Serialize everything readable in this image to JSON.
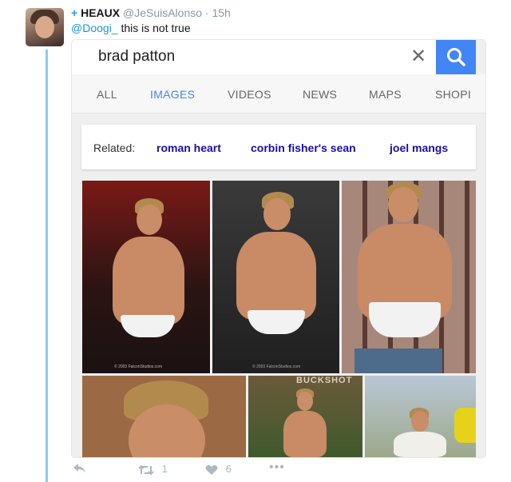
{
  "tweet": {
    "plus": "+",
    "author_name": "HEAUX",
    "handle": "@JeSuisAlonso",
    "separator": "·",
    "time": "15h",
    "mention": "@Doogi_",
    "text": " this is not true"
  },
  "search": {
    "query": "brad patton",
    "clear_icon": "close-icon",
    "search_icon": "search-icon",
    "accent": "#4285f4"
  },
  "tabs": [
    {
      "label": "ALL",
      "active": false
    },
    {
      "label": "IMAGES",
      "active": true
    },
    {
      "label": "VIDEOS",
      "active": false
    },
    {
      "label": "NEWS",
      "active": false
    },
    {
      "label": "MAPS",
      "active": false
    },
    {
      "label": "SHOPI",
      "active": false
    }
  ],
  "related": {
    "label": "Related:",
    "links": [
      "roman heart",
      "corbin fisher's sean",
      "joel mangs"
    ]
  },
  "images": {
    "watermarks": [
      "© 2003 FalconStudios.com",
      "© 2003 FalconStudios.com"
    ],
    "banner": "BUCKSHOT"
  },
  "actions": {
    "reply_icon": "reply-icon",
    "retweet_count": "1",
    "like_count": "6",
    "more_icon": "more-icon"
  }
}
